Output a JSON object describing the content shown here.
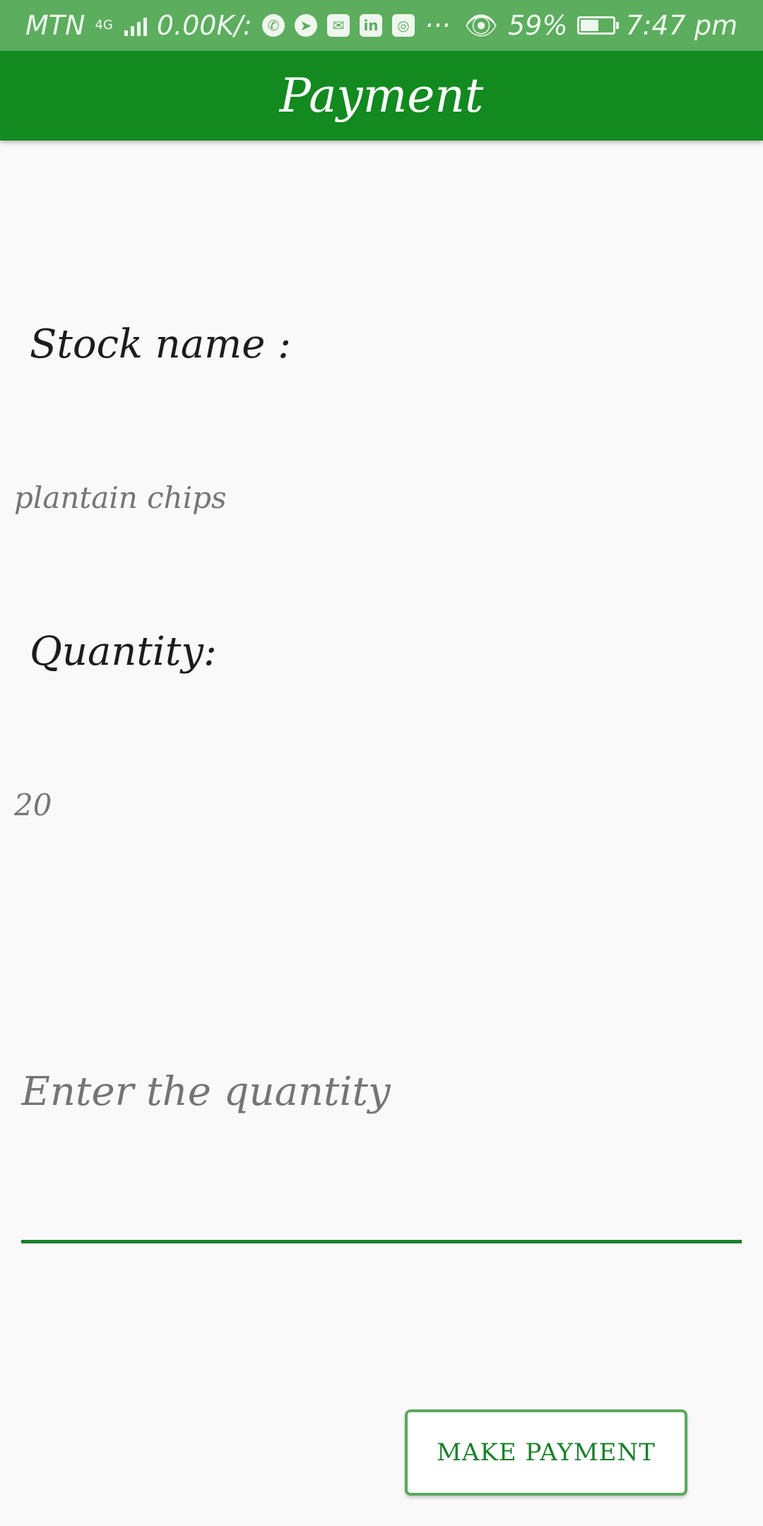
{
  "status_bar": {
    "carrier": "MTN",
    "network": "4G",
    "speed": "0.00K/:",
    "more": "···",
    "battery": "59%",
    "time": "7:47 pm",
    "battery_level": 0.59
  },
  "app_bar": {
    "title": "Payment"
  },
  "form": {
    "stock_label": "Stock  name :",
    "stock_value": "plantain chips",
    "quantity_label": "Quantity:",
    "quantity_value": "20",
    "quantity_input_placeholder": "Enter the quantity"
  },
  "actions": {
    "make_payment_label": "MAKE PAYMENT"
  },
  "colors": {
    "app_bar": "#128a20",
    "status_bar": "#5cad5e",
    "accent": "#1b7f2a"
  }
}
